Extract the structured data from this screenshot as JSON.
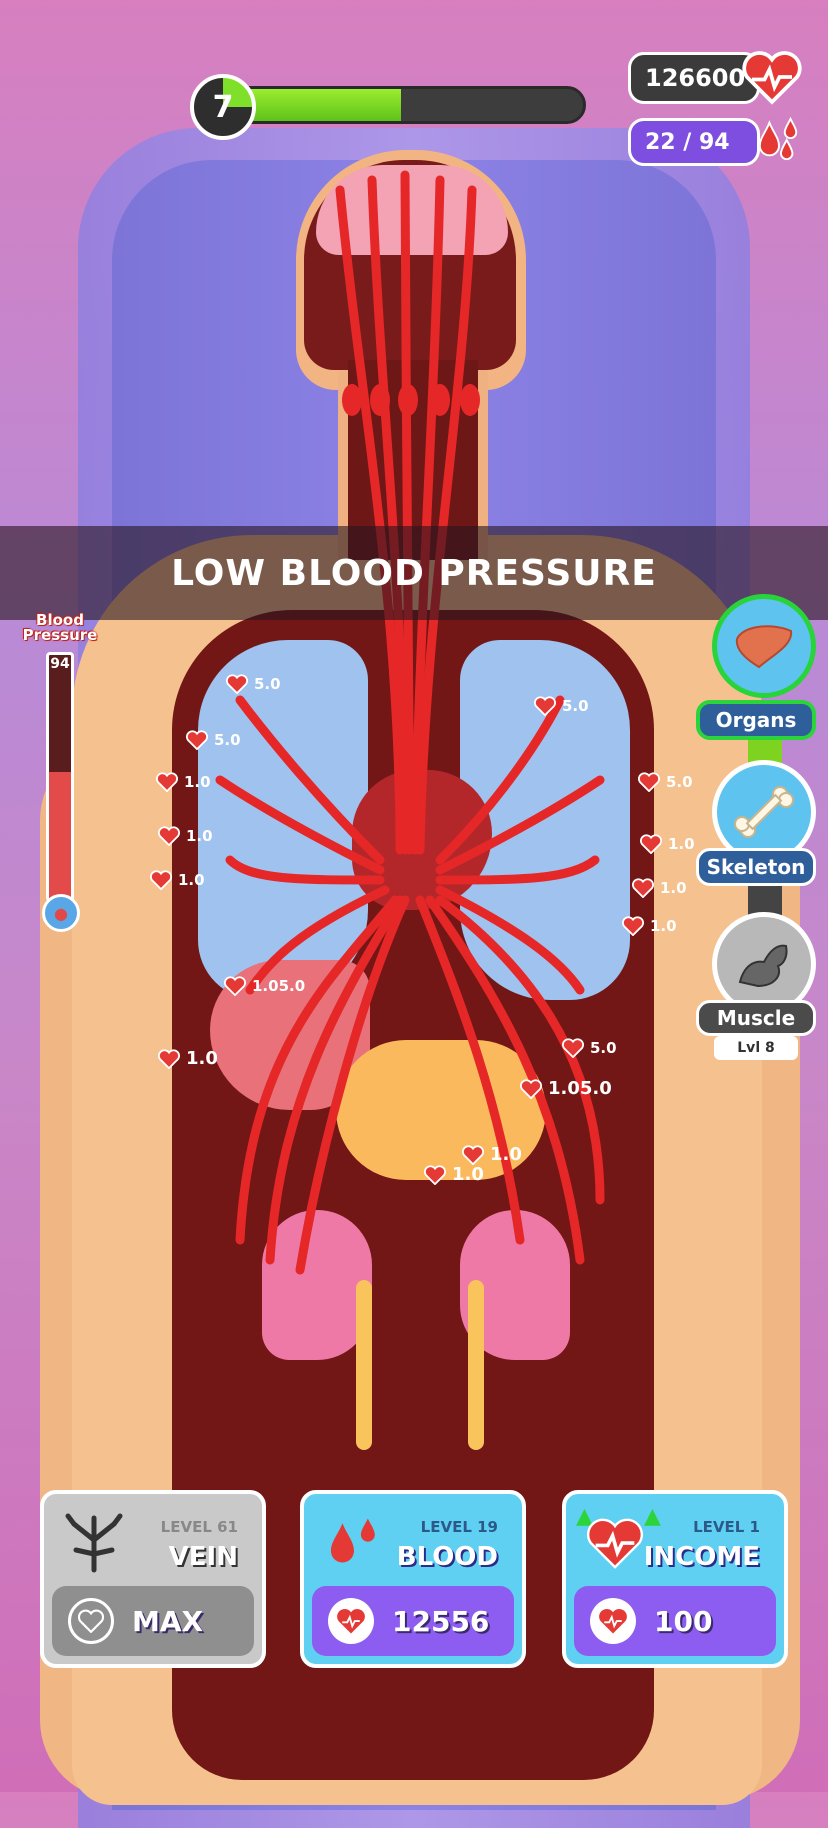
{
  "hud": {
    "level": "7",
    "level_progress": 0.48,
    "currency_value": "126600",
    "blood_drops": "22 / 94"
  },
  "banner": {
    "text": "LOW BLOOD PRESSURE"
  },
  "blood_pressure": {
    "title_line1": "Blood",
    "title_line2": "Pressure",
    "value": "94",
    "fill_fraction": 0.52
  },
  "floating_labels": [
    {
      "text": "5.0"
    },
    {
      "text": "5.0"
    },
    {
      "text": "5.0"
    },
    {
      "text": "1.0"
    },
    {
      "text": "1.0"
    },
    {
      "text": "1.0"
    },
    {
      "text": "5.0"
    },
    {
      "text": "1.0"
    },
    {
      "text": "1.0"
    },
    {
      "text": "1.0"
    },
    {
      "text": "1.05.0"
    },
    {
      "text": "1.0"
    },
    {
      "text": "5.0"
    },
    {
      "text": "1.05.0"
    },
    {
      "text": "1.0"
    },
    {
      "text": "1.0"
    }
  ],
  "side_menu": {
    "organs": "Organs",
    "skeleton": "Skeleton",
    "muscle": "Muscle",
    "muscle_level": "Lvl 8"
  },
  "cards": {
    "vein": {
      "level": "LEVEL 61",
      "name": "VEIN",
      "action": "MAX"
    },
    "blood": {
      "level": "LEVEL 19",
      "name": "BLOOD",
      "action": "12556"
    },
    "income": {
      "level": "LEVEL 1",
      "name": "INCOME",
      "action": "100"
    }
  },
  "colors": {
    "accent_green": "#7fe02b",
    "blood_red": "#e53935",
    "purple": "#8d5cf0",
    "teal": "#56cdf0"
  }
}
